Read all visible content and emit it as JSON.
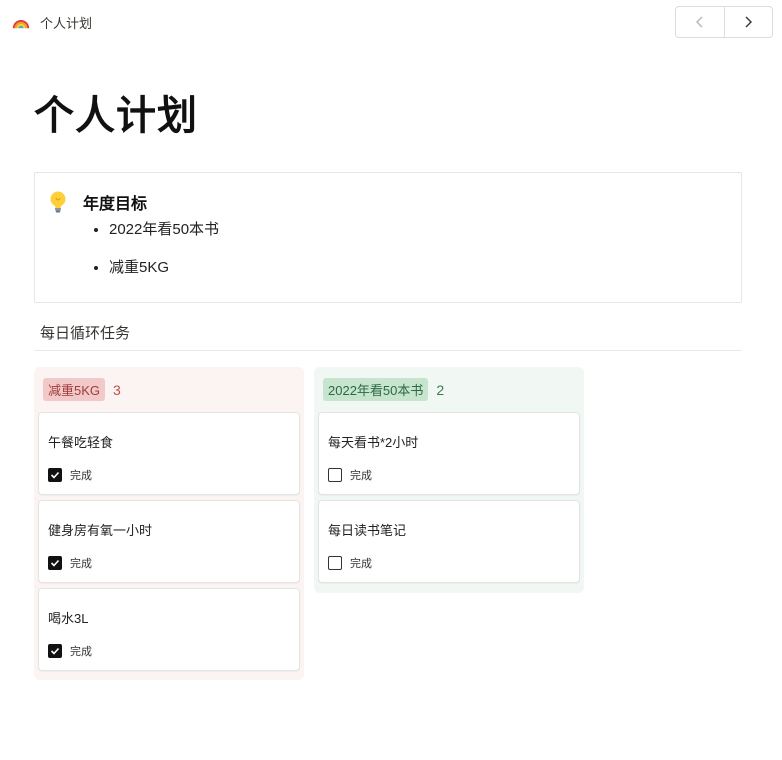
{
  "topbar": {
    "page_icon": "rainbow-icon",
    "breadcrumb": "个人计划",
    "nav_prev_icon": "chevron-left-icon",
    "nav_next_icon": "chevron-right-icon"
  },
  "page": {
    "title": "个人计划"
  },
  "callout": {
    "icon": "lightbulb-icon",
    "title": "年度目标",
    "items": [
      "2022年看50本书",
      "减重5KG"
    ]
  },
  "section": {
    "title": "每日循环任务"
  },
  "board": {
    "columns": [
      {
        "tag": "减重5KG",
        "count": "3",
        "color": "#fcf3f3",
        "cards": [
          {
            "title": "午餐吃轻食",
            "checkbox_label": "完成",
            "checked": true
          },
          {
            "title": "健身房有氧一小时",
            "checkbox_label": "完成",
            "checked": true
          },
          {
            "title": "喝水3L",
            "checkbox_label": "完成",
            "checked": true
          }
        ]
      },
      {
        "tag": "2022年看50本书",
        "count": "2",
        "color": "#f1f7f3",
        "cards": [
          {
            "title": "每天看书*2小时",
            "checkbox_label": "完成",
            "checked": false
          },
          {
            "title": "每日读书笔记",
            "checkbox_label": "完成",
            "checked": false
          }
        ]
      }
    ]
  }
}
